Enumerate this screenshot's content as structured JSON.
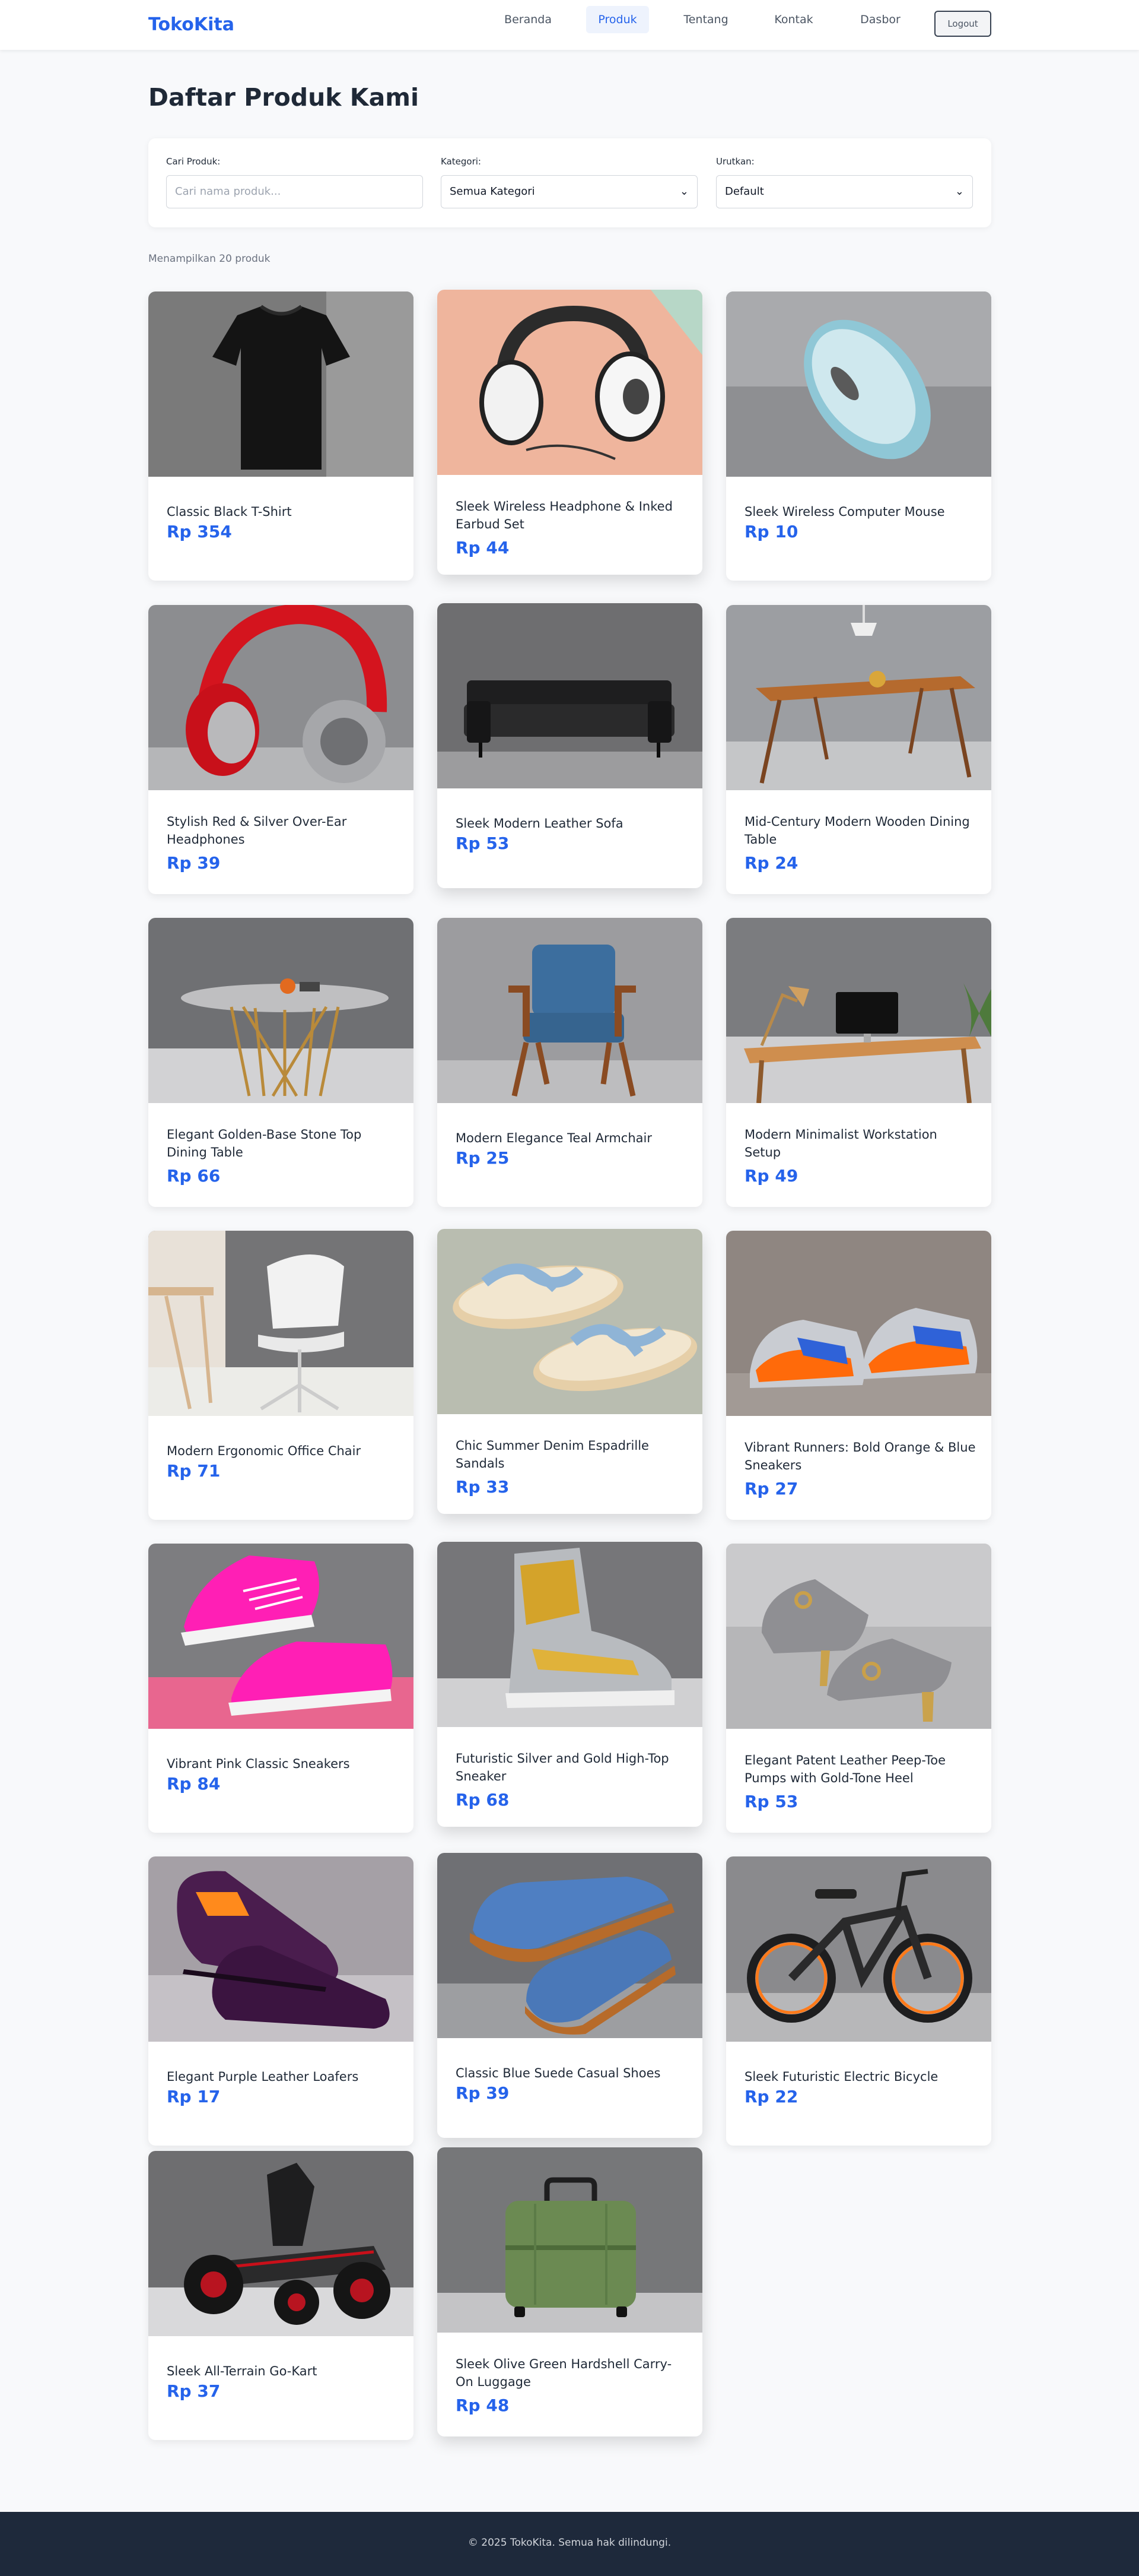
{
  "navbar": {
    "brand": "TokoKita",
    "links": [
      {
        "label": "Beranda",
        "active": false
      },
      {
        "label": "Produk",
        "active": true
      },
      {
        "label": "Tentang",
        "active": false
      },
      {
        "label": "Kontak",
        "active": false
      },
      {
        "label": "Dasbor",
        "active": false
      }
    ],
    "logout_label": "Logout"
  },
  "page_title": "Daftar Produk Kami",
  "filters": {
    "search_label": "Cari Produk:",
    "search_placeholder": "Cari nama produk...",
    "search_value": "",
    "category_label": "Kategori:",
    "category_value": "Semua Kategori",
    "sort_label": "Urutkan:",
    "sort_value": "Default"
  },
  "result_count": "Menampilkan 20 produk",
  "products": [
    {
      "name": "Classic Black T-Shirt",
      "price": "Rp 354",
      "image": "tshirt"
    },
    {
      "name": "Sleek Wireless Headphone & Inked Earbud Set",
      "price": "Rp 44",
      "image": "headphone-white"
    },
    {
      "name": "Sleek Wireless Computer Mouse",
      "price": "Rp 10",
      "image": "mouse"
    },
    {
      "name": "Stylish Red & Silver Over-Ear Headphones",
      "price": "Rp 39",
      "image": "headphone-red"
    },
    {
      "name": "Sleek Modern Leather Sofa",
      "price": "Rp 53",
      "image": "sofa"
    },
    {
      "name": "Mid-Century Modern Wooden Dining Table",
      "price": "Rp 24",
      "image": "wood-table"
    },
    {
      "name": "Elegant Golden-Base Stone Top Dining Table",
      "price": "Rp 66",
      "image": "gold-table"
    },
    {
      "name": "Modern Elegance Teal Armchair",
      "price": "Rp 25",
      "image": "armchair"
    },
    {
      "name": "Modern Minimalist Workstation Setup",
      "price": "Rp 49",
      "image": "workstation"
    },
    {
      "name": "Modern Ergonomic Office Chair",
      "price": "Rp 71",
      "image": "office-chair"
    },
    {
      "name": "Chic Summer Denim Espadrille Sandals",
      "price": "Rp 33",
      "image": "sandals"
    },
    {
      "name": "Vibrant Runners: Bold Orange & Blue Sneakers",
      "price": "Rp 27",
      "image": "runners"
    },
    {
      "name": "Vibrant Pink Classic Sneakers",
      "price": "Rp 84",
      "image": "pink-sneakers"
    },
    {
      "name": "Futuristic Silver and Gold High-Top Sneaker",
      "price": "Rp 68",
      "image": "hightop"
    },
    {
      "name": "Elegant Patent Leather Peep-Toe Pumps with Gold-Tone Heel",
      "price": "Rp 53",
      "image": "pumps"
    },
    {
      "name": "Elegant Purple Leather Loafers",
      "price": "Rp 17",
      "image": "loafers"
    },
    {
      "name": "Classic Blue Suede Casual Shoes",
      "price": "Rp 39",
      "image": "suede-shoes"
    },
    {
      "name": "Sleek Futuristic Electric Bicycle",
      "price": "Rp 22",
      "image": "ebike"
    },
    {
      "name": "Sleek All-Terrain Go-Kart",
      "price": "Rp 37",
      "image": "gokart"
    },
    {
      "name": "Sleek Olive Green Hardshell Carry-On Luggage",
      "price": "Rp 48",
      "image": "luggage"
    }
  ],
  "footer_text": "© 2025 TokoKita. Semua hak dilindungi.",
  "colors": {
    "accent": "#2563eb",
    "footer_bg": "#1e293b",
    "page_bg": "#f8f9fb"
  }
}
